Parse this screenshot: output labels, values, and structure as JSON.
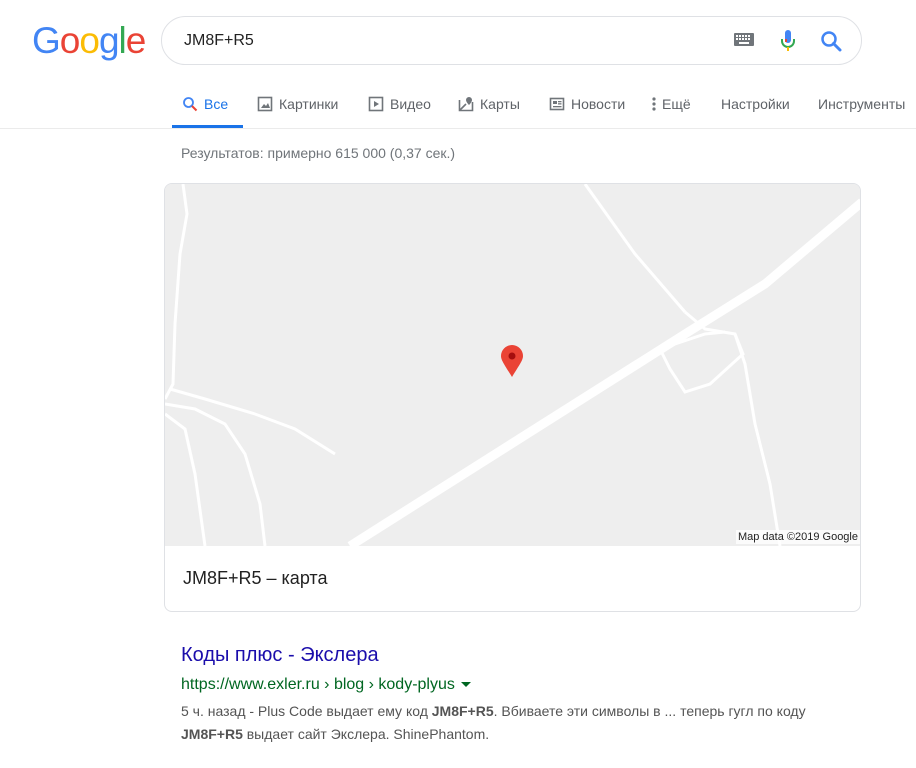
{
  "logo": {
    "text": "Google",
    "colors": [
      "#4285F4",
      "#EA4335",
      "#FBBC05",
      "#4285F4",
      "#34A853",
      "#EA4335"
    ]
  },
  "search": {
    "query": "JM8F+R5",
    "icons": [
      "keyboard-icon",
      "microphone-icon",
      "search-icon"
    ]
  },
  "tabs": [
    {
      "label": "Все",
      "icon": "search-icon",
      "active": true
    },
    {
      "label": "Картинки",
      "icon": "image-icon"
    },
    {
      "label": "Видео",
      "icon": "video-icon"
    },
    {
      "label": "Карты",
      "icon": "map-icon"
    },
    {
      "label": "Новости",
      "icon": "news-icon"
    },
    {
      "label": "Ещё",
      "icon": "more-icon"
    },
    {
      "label": "Настройки"
    },
    {
      "label": "Инструменты"
    }
  ],
  "stats": "Результатов: примерно 615 000 (0,37 сек.)",
  "map_card": {
    "attribution": "Map data ©2019 Google",
    "title": "JM8F+R5 – карта"
  },
  "result": {
    "title": "Коды плюс - Экслера",
    "url": "https://www.exler.ru › blog › kody-plyus",
    "snippet_parts": [
      {
        "text": "5 ч. назад - Plus Code выдает ему код ",
        "bold": false
      },
      {
        "text": "JM8F+R5",
        "bold": true
      },
      {
        "text": ". Вбиваете эти символы в ... теперь гугл по коду ",
        "bold": false
      },
      {
        "text": "JM8F+R5",
        "bold": true
      },
      {
        "text": " выдает сайт Экслера. ShinePhantom.",
        "bold": false
      }
    ]
  },
  "colors": {
    "accent": "#1a73e8",
    "link": "#1a0dab",
    "url": "#006621",
    "pin": "#ea4335"
  }
}
